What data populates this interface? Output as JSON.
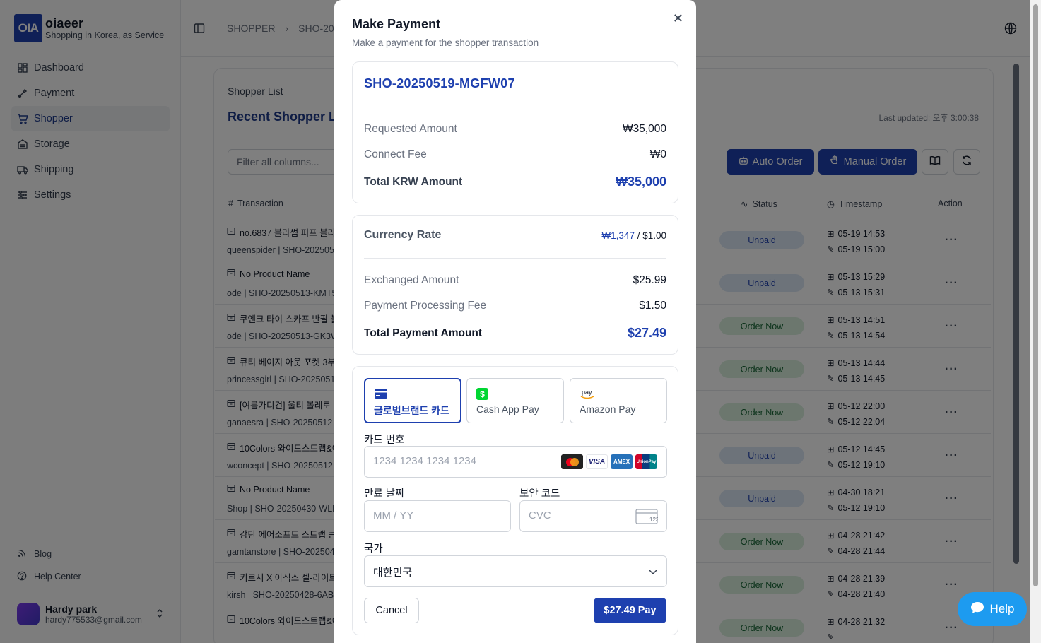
{
  "brand": {
    "logo": "OIA",
    "name": "oiaeer",
    "tagline": "Shopping in Korea, as Service"
  },
  "sidebar": {
    "items": [
      {
        "label": "Dashboard",
        "icon": "dashboard-icon"
      },
      {
        "label": "Payment",
        "icon": "payment-icon"
      },
      {
        "label": "Shopper",
        "icon": "cart-icon",
        "active": true
      },
      {
        "label": "Storage",
        "icon": "storage-icon"
      },
      {
        "label": "Shipping",
        "icon": "truck-icon"
      },
      {
        "label": "Settings",
        "icon": "settings-icon"
      }
    ],
    "bottom": [
      {
        "label": "Blog"
      },
      {
        "label": "Help Center"
      }
    ],
    "user": {
      "name": "Hardy park",
      "email": "hardy775533@gmail.com"
    }
  },
  "header": {
    "crumb1": "SHOPPER",
    "crumb2": "SHO-202"
  },
  "page": {
    "subtitle": "Shopper List",
    "title": "Recent Shopper Li",
    "last_updated": "Last updated: 오후 3:00:38",
    "filter_placeholder": "Filter all columns...",
    "auto_order": "Auto Order",
    "manual_order": "Manual Order"
  },
  "table": {
    "headers": {
      "transaction": "Transaction",
      "status": "Status",
      "timestamp": "Timestamp",
      "action": "Action"
    },
    "rows": [
      {
        "title": "no.6837 블라썸 퍼프 블라",
        "sub": "queenspider | SHO-2025051",
        "status": "Unpaid",
        "t1": "05-19 14:53",
        "t2": "05-19 15:00"
      },
      {
        "title": "No Product Name",
        "sub": "ode | SHO-20250513-KMT5",
        "status": "Unpaid",
        "t1": "05-13 15:29",
        "t2": "05-13 15:31"
      },
      {
        "title": "쿠엔크 타이 스카프 반팔 블라",
        "sub": "ode | SHO-20250513-GK3W",
        "status": "Order Now",
        "t1": "05-13 14:51",
        "t2": "05-13 14:54"
      },
      {
        "title": "큐티 베이지 아웃 포켓 3부",
        "sub": "princessgirl | SHO-2025051",
        "status": "Order Now",
        "t1": "05-13 14:44",
        "t2": "05-13 14:45"
      },
      {
        "title": "[여름가디건] 울티 볼레로 (3",
        "sub": "ganaesra | SHO-20250512-",
        "status": "Order Now",
        "t1": "05-12 22:00",
        "t2": "05-12 22:04"
      },
      {
        "title": "10Colors 와이드스트랩&에",
        "sub": "wconcept | SHO-20250512-",
        "status": "Unpaid",
        "t1": "05-12 14:45",
        "t2": "05-12 19:10"
      },
      {
        "title": "No Product Name",
        "sub": "Shop | SHO-20250430-WLD",
        "status": "Unpaid",
        "t1": "04-30 18:21",
        "t2": "05-12 19:10"
      },
      {
        "title": "감탄 에어소프트 스트랩 큰컵",
        "sub": "gamtanstore | SHO-202504",
        "status": "Order Now",
        "t1": "04-28 21:42",
        "t2": "04-28 21:44"
      },
      {
        "title": "키르시 X 아식스 젤-라이트",
        "sub": "kirsh | SHO-20250428-6AB",
        "status": "Order Now",
        "t1": "04-28 21:39",
        "t2": "04-28 21:40"
      },
      {
        "title": "10Colors 와이드스트랩&에",
        "sub": "",
        "status": "Order Now",
        "t1": "04-28 21:32",
        "t2": ""
      }
    ]
  },
  "modal": {
    "title": "Make Payment",
    "description": "Make a payment for the shopper transaction",
    "transaction_id": "SHO-20250519-MGFW07",
    "requested_label": "Requested Amount",
    "requested_value": "₩35,000",
    "connect_label": "Connect Fee",
    "connect_value": "₩0",
    "total_krw_label": "Total KRW Amount",
    "total_krw_value": "₩35,000",
    "rate_label": "Currency Rate",
    "rate_krw": "₩1,347",
    "rate_usd": " / $1.00",
    "exchanged_label": "Exchanged Amount",
    "exchanged_value": "$25.99",
    "fee_label": "Payment Processing Fee",
    "fee_value": "$1.50",
    "total_label": "Total Payment Amount",
    "total_value": "$27.49",
    "methods": [
      {
        "label": "글로벌브랜드 카드",
        "icon": "credit-card-icon"
      },
      {
        "label": "Cash App Pay",
        "icon": "cash-app-icon"
      },
      {
        "label": "Amazon Pay",
        "icon": "amazon-pay-icon"
      }
    ],
    "card_label": "카드 번호",
    "card_placeholder": "1234 1234 1234 1234",
    "expiry_label": "만료 날짜",
    "expiry_placeholder": "MM / YY",
    "cvc_label": "보안 코드",
    "cvc_placeholder": "CVC",
    "country_label": "국가",
    "country_value": "대한민국",
    "cancel": "Cancel",
    "pay": "$27.49 Pay"
  },
  "help": "Help"
}
